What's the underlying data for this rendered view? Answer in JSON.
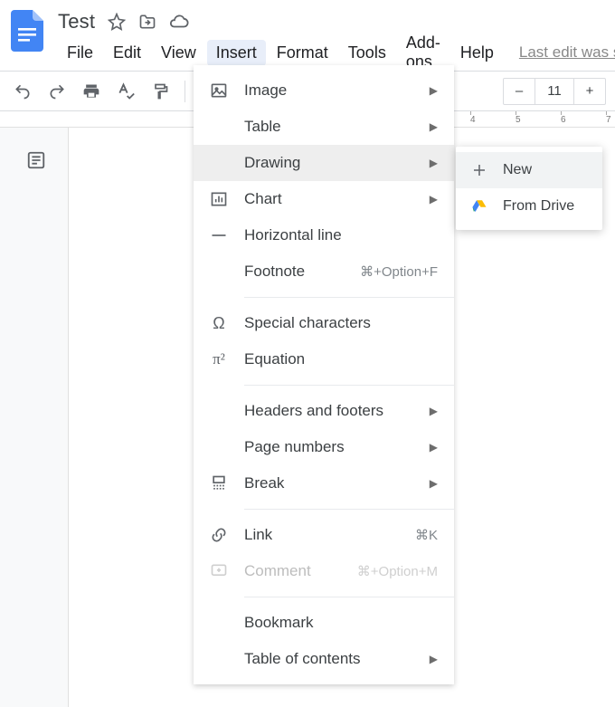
{
  "header": {
    "doc_title": "Test",
    "last_edit": "Last edit was s"
  },
  "menubar": {
    "file": "File",
    "edit": "Edit",
    "view": "View",
    "insert": "Insert",
    "format": "Format",
    "tools": "Tools",
    "addons": "Add-ons",
    "help": "Help"
  },
  "toolbar": {
    "font_size": "11",
    "minus": "–",
    "plus": "+"
  },
  "ruler": {
    "t4": "4",
    "t5": "5",
    "t6": "6",
    "t7": "7"
  },
  "insert_menu": {
    "image": "Image",
    "table": "Table",
    "drawing": "Drawing",
    "chart": "Chart",
    "hline": "Horizontal line",
    "footnote": "Footnote",
    "footnote_sc": "⌘+Option+F",
    "special": "Special characters",
    "equation": "Equation",
    "headers": "Headers and footers",
    "pagenums": "Page numbers",
    "break": "Break",
    "link": "Link",
    "link_sc": "⌘K",
    "comment": "Comment",
    "comment_sc": "⌘+Option+M",
    "bookmark": "Bookmark",
    "toc": "Table of contents"
  },
  "drawing_submenu": {
    "new": "New",
    "from_drive": "From Drive"
  }
}
